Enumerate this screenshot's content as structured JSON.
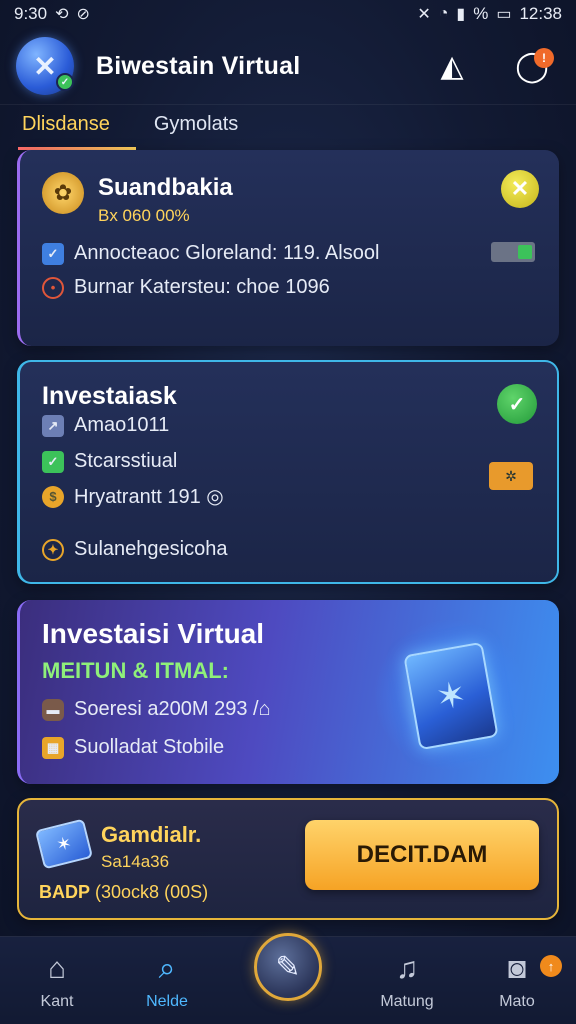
{
  "status_bar": {
    "time_left": "9:30",
    "battery_percent": "%",
    "time_right": "12:38"
  },
  "header": {
    "title": "Biwestain Virtual"
  },
  "tabs": [
    {
      "label": "Dlisdanse"
    },
    {
      "label": "Gymolats"
    }
  ],
  "card1": {
    "title": "Suandbakia",
    "subtitle": "Bx 060 00%",
    "rows": [
      {
        "icon": "checkbox-icon",
        "text": "Annocteaoc Gloreland: 119. Alsool"
      },
      {
        "icon": "target-icon",
        "text": "Burnar Katersteu: choe 1096"
      }
    ]
  },
  "card2": {
    "title": "Investaiask",
    "rows": [
      {
        "icon": "chart-icon",
        "text": "Amao1011"
      },
      {
        "icon": "check-icon",
        "text": "Stcarsstiual"
      },
      {
        "icon": "coin-icon",
        "text": "Hryatrantt 191 ◎"
      },
      {
        "icon": "star-icon",
        "text": "Sulanehgesicoha"
      }
    ]
  },
  "card3": {
    "title": "Investaisi Virtual",
    "subtitle": "MEITUN & ITMAL:",
    "rows": [
      {
        "icon": "wallet-icon",
        "text": "Soeresi a200M 293 /⌂"
      },
      {
        "icon": "building-icon",
        "text": "Suolladat Stobile"
      }
    ]
  },
  "card4": {
    "title": "Gamdialr.",
    "subtitle": "Sa14a36",
    "line_bold": "BADP",
    "line_rest": "(30ock8 (00S)",
    "cta_label": "DECIT.DAM"
  },
  "bottom_nav": [
    {
      "label": "Kant"
    },
    {
      "label": "Nelde"
    },
    {
      "label": ""
    },
    {
      "label": "Matung"
    },
    {
      "label": "Mato"
    }
  ],
  "colors": {
    "accent_gold": "#ffd45c",
    "accent_blue": "#4fb8ff",
    "accent_green": "#8ff07a"
  }
}
